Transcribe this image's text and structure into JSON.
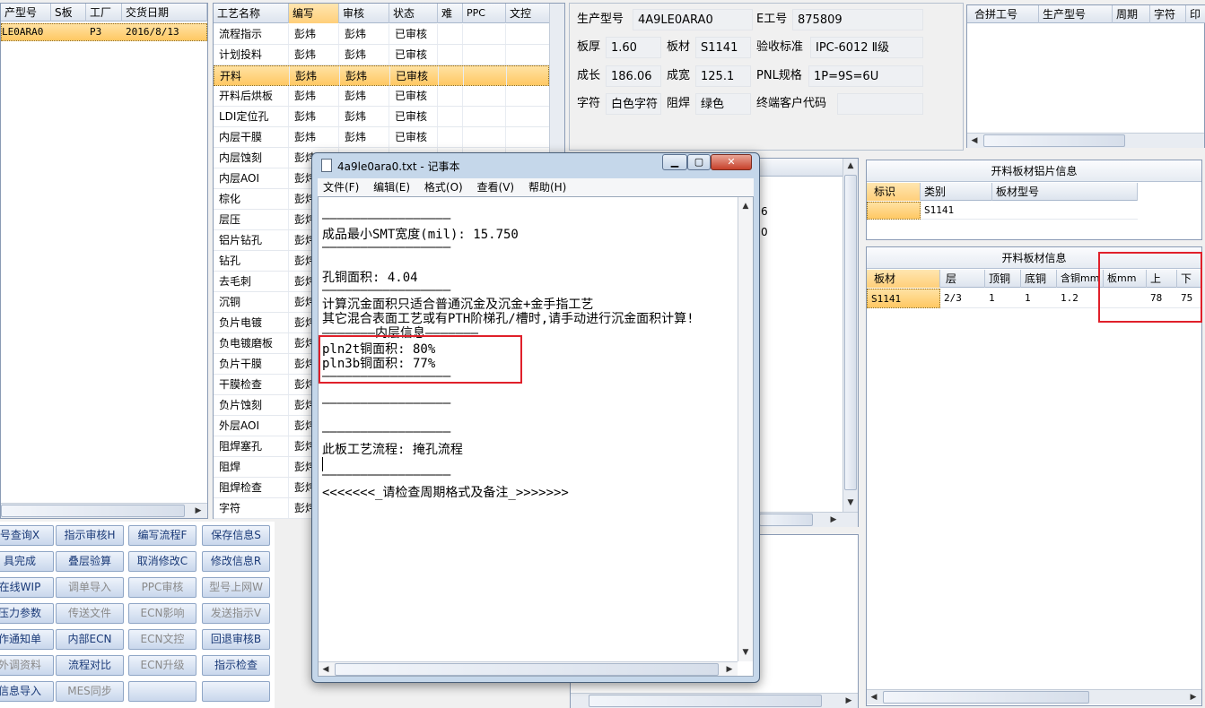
{
  "left_grid": {
    "headers": [
      "产型号",
      "S板",
      "工厂",
      "交货日期"
    ],
    "row": {
      "model": "LE0ARA0",
      "factory": "P3",
      "date": "2016/8/13"
    }
  },
  "process_grid": {
    "headers": [
      "工艺名称",
      "编写",
      "审核",
      "状态",
      "难",
      "PPC",
      "文控"
    ],
    "rows": [
      {
        "name": "流程指示",
        "writer": "彭炜",
        "reviewer": "彭炜",
        "status": "已审核"
      },
      {
        "name": "计划投料",
        "writer": "彭炜",
        "reviewer": "彭炜",
        "status": "已审核"
      },
      {
        "name": "开料",
        "writer": "彭炜",
        "reviewer": "彭炜",
        "status": "已审核"
      },
      {
        "name": "开料后烘板",
        "writer": "彭炜",
        "reviewer": "彭炜",
        "status": "已审核"
      },
      {
        "name": "LDI定位孔",
        "writer": "彭炜",
        "reviewer": "彭炜",
        "status": "已审核"
      },
      {
        "name": "内层干膜",
        "writer": "彭炜",
        "reviewer": "彭炜",
        "status": "已审核"
      },
      {
        "name": "内层蚀刻",
        "writer": "彭炜"
      },
      {
        "name": "内层AOI",
        "writer": "彭炜"
      },
      {
        "name": "棕化",
        "writer": "彭炜"
      },
      {
        "name": "层压",
        "writer": "彭炜"
      },
      {
        "name": "铝片钻孔",
        "writer": "彭炜"
      },
      {
        "name": "钻孔",
        "writer": "彭炜"
      },
      {
        "name": "去毛刺",
        "writer": "彭炜"
      },
      {
        "name": "沉铜",
        "writer": "彭炜"
      },
      {
        "name": "负片电镀",
        "writer": "彭炜"
      },
      {
        "name": "负电镀磨板",
        "writer": "彭炜"
      },
      {
        "name": "负片干膜",
        "writer": "彭炜"
      },
      {
        "name": "干膜检查",
        "writer": "彭炜"
      },
      {
        "name": "负片蚀刻",
        "writer": "彭炜"
      },
      {
        "name": "外层AOI",
        "writer": "彭炜"
      },
      {
        "name": "阻焊塞孔",
        "writer": "彭炜"
      },
      {
        "name": "阻焊",
        "writer": "彭炜"
      },
      {
        "name": "阻焊检查",
        "writer": "彭炜"
      },
      {
        "name": "字符",
        "writer": "彭炜"
      }
    ]
  },
  "buttons": [
    [
      "号查询X",
      "指示审核H",
      "编写流程F",
      "保存信息S"
    ],
    [
      "具完成",
      "叠层验算",
      "取消修改C",
      "修改信息R"
    ],
    [
      "在线WIP",
      "调单导入",
      "PPC审核",
      "型号上网W"
    ],
    [
      "压力参数",
      "传送文件",
      "ECN影响",
      "发送指示V"
    ],
    [
      "作通知单",
      "内部ECN",
      "ECN文控",
      "回退审核B"
    ],
    [
      "外调资料",
      "流程对比",
      "ECN升级",
      "指示检查"
    ],
    [
      "信息导入",
      "MES同步",
      "",
      ""
    ]
  ],
  "info": {
    "model_label": "生产型号",
    "model": "4A9LE0ARA0",
    "eno_label": "E工号",
    "eno": "875809",
    "thick_label": "板厚",
    "thick": "1.60",
    "mat_label": "板材",
    "mat": "S1141",
    "std_label": "验收标准",
    "std": "IPC-6012 Ⅱ级",
    "len_label": "成长",
    "len": "186.06",
    "wid_label": "成宽",
    "wid": "125.1",
    "pnl_label": "PNL规格",
    "pnl": "1P=9S=6U",
    "char_label": "字符",
    "char": "白色字符",
    "mask_label": "阻焊",
    "mask": "绿色",
    "cust_label": "终端客户代码",
    "cust": ""
  },
  "merge_grid": {
    "headers": [
      "合拼工号",
      "生产型号",
      "周期",
      "字符",
      "印"
    ]
  },
  "alu_panel": {
    "title": "开料板材铝片信息",
    "headers": [
      "标识",
      "类别",
      "板材型号"
    ],
    "row": {
      "tag": "",
      "type": "S1141",
      "model": ""
    }
  },
  "cut_panel": {
    "title": "开料板材信息",
    "headers": [
      "板材",
      "层",
      "顶铜",
      "底铜",
      "含铜mm",
      "板mm",
      "上",
      "下"
    ],
    "row": [
      "S1141",
      "2/3",
      "1",
      "1",
      "1.2",
      "",
      "78",
      "75"
    ]
  },
  "mid_partial": [
    "6",
    "0"
  ],
  "notepad": {
    "title": "4a9le0ara0.txt - 记事本",
    "menu": [
      "文件(F)",
      "编辑(E)",
      "格式(O)",
      "查看(V)",
      "帮助(H)"
    ],
    "lines": [
      "—————————————————",
      "成品最小SMT宽度(mil): 15.750",
      "—————————————————",
      "孔铜面积: 4.04",
      "—————————————————",
      "计算沉金面积只适合普通沉金及沉金+金手指工艺",
      "其它混合表面工艺或有PTH阶梯孔/槽时,请手动进行沉金面积计算!",
      "———————内层信息———————",
      "pln2t铜面积: 80%",
      "pln3b铜面积: 77%",
      "—————————————————",
      "—————————————————",
      "—————————————————",
      "此板工艺流程: 掩孔流程",
      "—————————————————",
      "<<<<<<<_请检查周期格式及备注_>>>>>>>"
    ]
  }
}
